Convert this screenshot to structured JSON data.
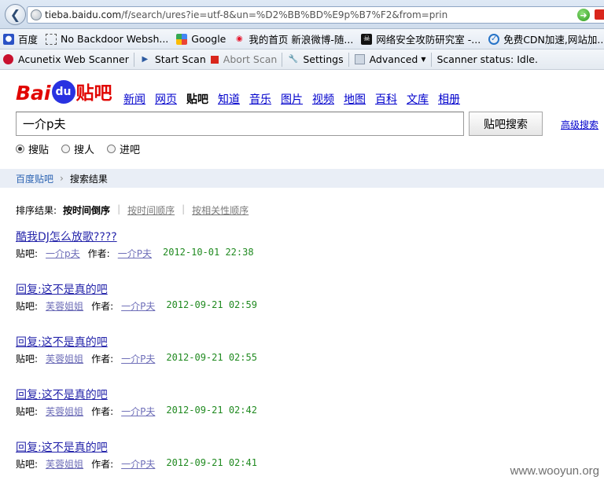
{
  "browser": {
    "url_prefix": "tieba.baidu.com",
    "url_rest": "/f/search/ures?ie=utf-8&un=%D2%BB%BD%E9p%B7%F2&from=prin",
    "bookmarks": [
      {
        "label": "百度",
        "icon": "baidu-paw-icon"
      },
      {
        "label": "No Backdoor Websh...",
        "icon": "blank-page-icon"
      },
      {
        "label": "Google",
        "icon": "google-icon"
      },
      {
        "label": "我的首页 新浪微博-随...",
        "icon": "weibo-icon"
      },
      {
        "label": "网络安全攻防研究室 -...",
        "icon": "skull-icon"
      },
      {
        "label": "免费CDN加速,网站加...",
        "icon": "cdn-icon"
      }
    ]
  },
  "acunetix": {
    "scanner": "Acunetix Web Scanner",
    "start": "Start Scan",
    "abort": "Abort Scan",
    "settings": "Settings",
    "advanced": "Advanced",
    "status": "Scanner status: Idle."
  },
  "baidu": {
    "logo_left": "Bai",
    "logo_mid": "du",
    "logo_right": "贴吧",
    "nav": [
      "新闻",
      "网页",
      "贴吧",
      "知道",
      "音乐",
      "图片",
      "视频",
      "地图",
      "百科",
      "文库",
      "相册"
    ],
    "search_value": "一介p夫",
    "search_button": "贴吧搜索",
    "advanced_search": "高级搜索",
    "radios": [
      {
        "label": "搜贴",
        "checked": true
      },
      {
        "label": "搜人",
        "checked": false
      },
      {
        "label": "进吧",
        "checked": false
      }
    ]
  },
  "breadcrumb": {
    "home": "百度贴吧",
    "current": "搜索结果"
  },
  "sort": {
    "label": "排序结果:",
    "current": "按时间倒序",
    "options": [
      "按时间顺序",
      "按相关性顺序"
    ]
  },
  "meta_labels": {
    "bar": "贴吧:",
    "author": "作者:"
  },
  "results": [
    {
      "title": "酷我DJ怎么放歌????",
      "bar": "一介p夫",
      "author": "一介P夫",
      "time": "2012-10-01 22:38"
    },
    {
      "title": "回复:这不是真的吧",
      "bar": "芙蓉姐姐",
      "author": "一介P夫",
      "time": "2012-09-21 02:59"
    },
    {
      "title": "回复:这不是真的吧",
      "bar": "芙蓉姐姐",
      "author": "一介P夫",
      "time": "2012-09-21 02:55"
    },
    {
      "title": "回复:这不是真的吧",
      "bar": "芙蓉姐姐",
      "author": "一介P夫",
      "time": "2012-09-21 02:42"
    },
    {
      "title": "回复:这不是真的吧",
      "bar": "芙蓉姐姐",
      "author": "一介P夫",
      "time": "2012-09-21 02:41"
    }
  ],
  "watermark": "www.wooyun.org"
}
